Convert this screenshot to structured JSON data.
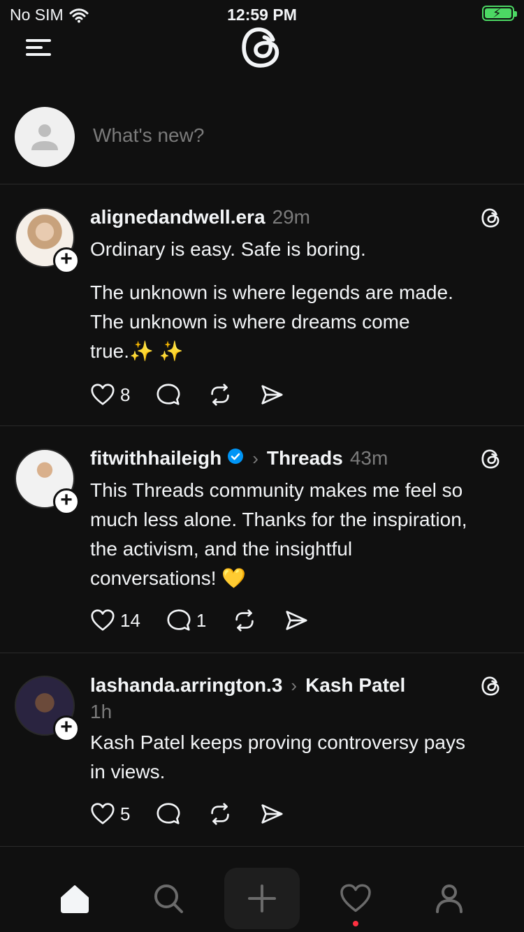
{
  "status_bar": {
    "carrier": "No SIM",
    "time": "12:59 PM"
  },
  "composer": {
    "placeholder": "What's new?"
  },
  "posts": [
    {
      "username": "alignedandwell.era",
      "time": "29m",
      "text_lines": [
        "Ordinary is easy. Safe is boring.",
        "The unknown is where legends are made.",
        "The unknown is where dreams come",
        "true.✨ ✨"
      ],
      "likes": "8",
      "replies": ""
    },
    {
      "username": "fitwithhaileigh",
      "verified": true,
      "topic": "Threads",
      "time": "43m",
      "text_lines": [
        "This Threads community makes me feel so",
        "much less alone. Thanks for the inspiration,",
        "the activism, and the insightful",
        "conversations! 💛"
      ],
      "likes": "14",
      "replies": "1"
    },
    {
      "username": "lashanda.arrington.3",
      "topic": "Kash Patel",
      "time": "1h",
      "text_lines": [
        "Kash Patel keeps proving controversy pays",
        "in views."
      ],
      "likes": "5",
      "replies": ""
    }
  ],
  "icons": [
    "menu-icon",
    "threads-logo-icon",
    "heart-icon",
    "comment-icon",
    "repost-icon",
    "share-icon",
    "home-icon",
    "search-icon",
    "plus-icon",
    "activity-icon",
    "profile-icon"
  ],
  "colors": {
    "background": "#101010",
    "text": "#f3f5f7",
    "secondary": "#7b7b7b",
    "verified": "#0095f6",
    "battery": "#4cd964",
    "notification": "#ff3040"
  }
}
